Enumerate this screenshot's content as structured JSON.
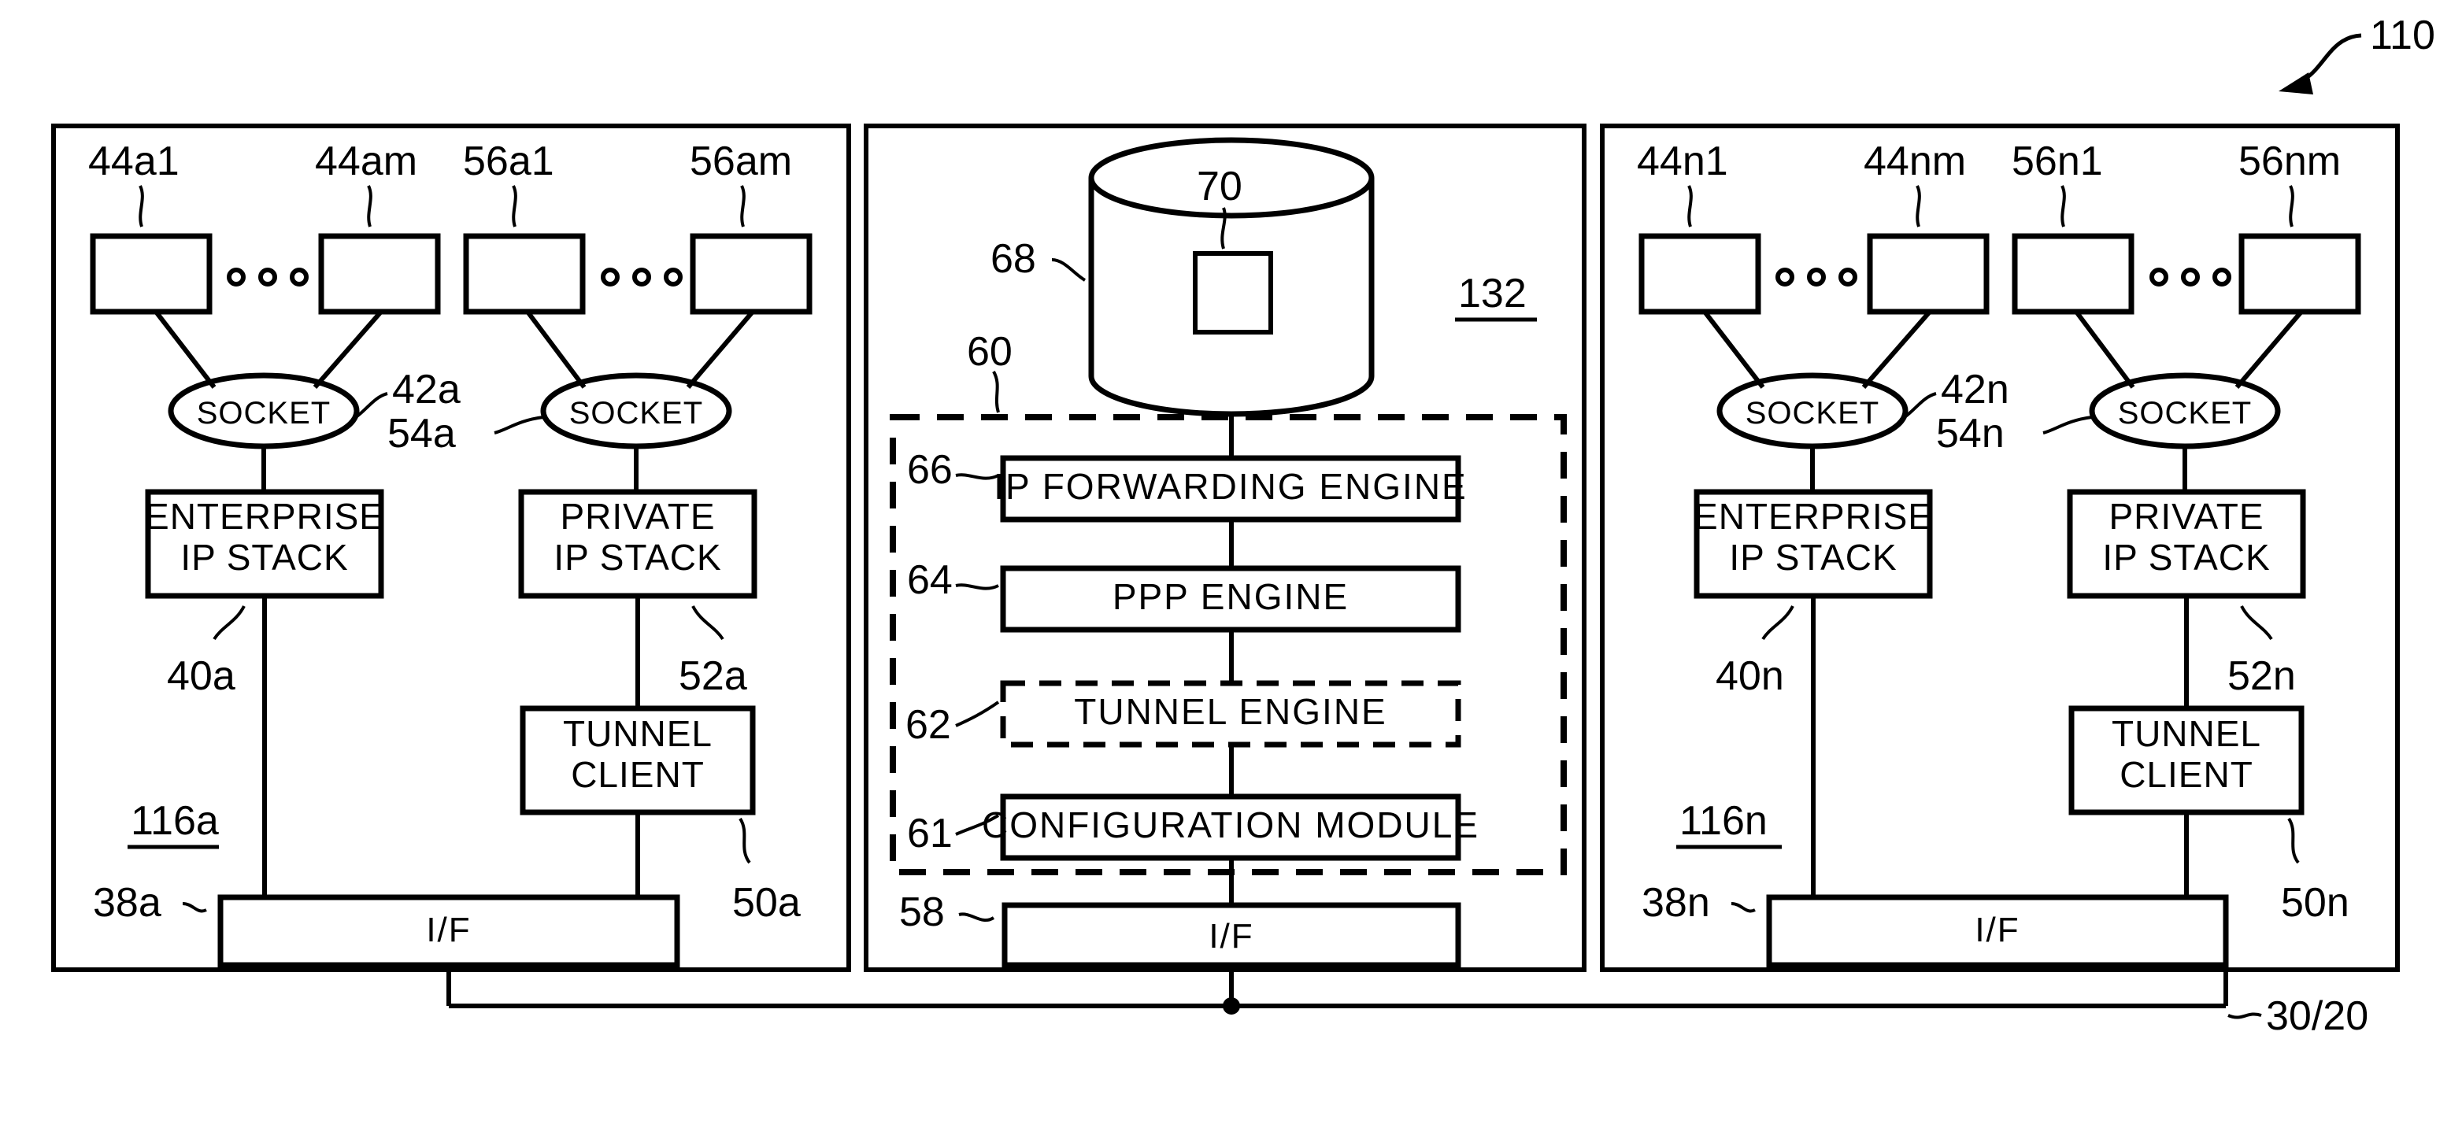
{
  "figure": {
    "number": "110",
    "panels": {
      "left": {
        "ref": "116a",
        "app_boxes_enterprise": [
          "44a1",
          "44am"
        ],
        "app_boxes_private": [
          "56a1",
          "56am"
        ],
        "socket_label": "SOCKET",
        "socket_ref_enterprise": "42a",
        "socket_ref_private": "54a",
        "enterprise_stack": {
          "line1": "ENTERPRISE",
          "line2": "IP STACK",
          "ref": "40a"
        },
        "private_stack": {
          "line1": "PRIVATE",
          "line2": "IP STACK",
          "ref": "52a"
        },
        "tunnel_client": {
          "line1": "TUNNEL",
          "line2": "CLIENT",
          "ref": "50a"
        },
        "interface": {
          "label": "I/F",
          "ref": "38a"
        },
        "ellipsis": "o o o"
      },
      "center": {
        "ref": "132",
        "database_ref": "68",
        "database_item_ref": "70",
        "dashed_group_ref": "60",
        "engines": [
          {
            "ref": "66",
            "label": "IP FORWARDING ENGINE",
            "style": "solid"
          },
          {
            "ref": "64",
            "label": "PPP ENGINE",
            "style": "solid"
          },
          {
            "ref": "62",
            "label": "TUNNEL ENGINE",
            "style": "dashed"
          },
          {
            "ref": "61",
            "label": "CONFIGURATION MODULE",
            "style": "solid"
          }
        ],
        "interface": {
          "label": "I/F",
          "ref": "58"
        }
      },
      "right": {
        "ref": "116n",
        "app_boxes_enterprise": [
          "44n1",
          "44nm"
        ],
        "app_boxes_private": [
          "56n1",
          "56nm"
        ],
        "socket_label": "SOCKET",
        "socket_ref_enterprise": "42n",
        "socket_ref_private": "54n",
        "enterprise_stack": {
          "line1": "ENTERPRISE",
          "line2": "IP STACK",
          "ref": "40n"
        },
        "private_stack": {
          "line1": "PRIVATE",
          "line2": "IP STACK",
          "ref": "52n"
        },
        "tunnel_client": {
          "line1": "TUNNEL",
          "line2": "CLIENT",
          "ref": "50n"
        },
        "interface": {
          "label": "I/F",
          "ref": "38n"
        },
        "ellipsis": "o o o"
      }
    },
    "bus_ref": "30/20"
  },
  "colors": {
    "ink": "#000000",
    "paper": "#ffffff"
  }
}
